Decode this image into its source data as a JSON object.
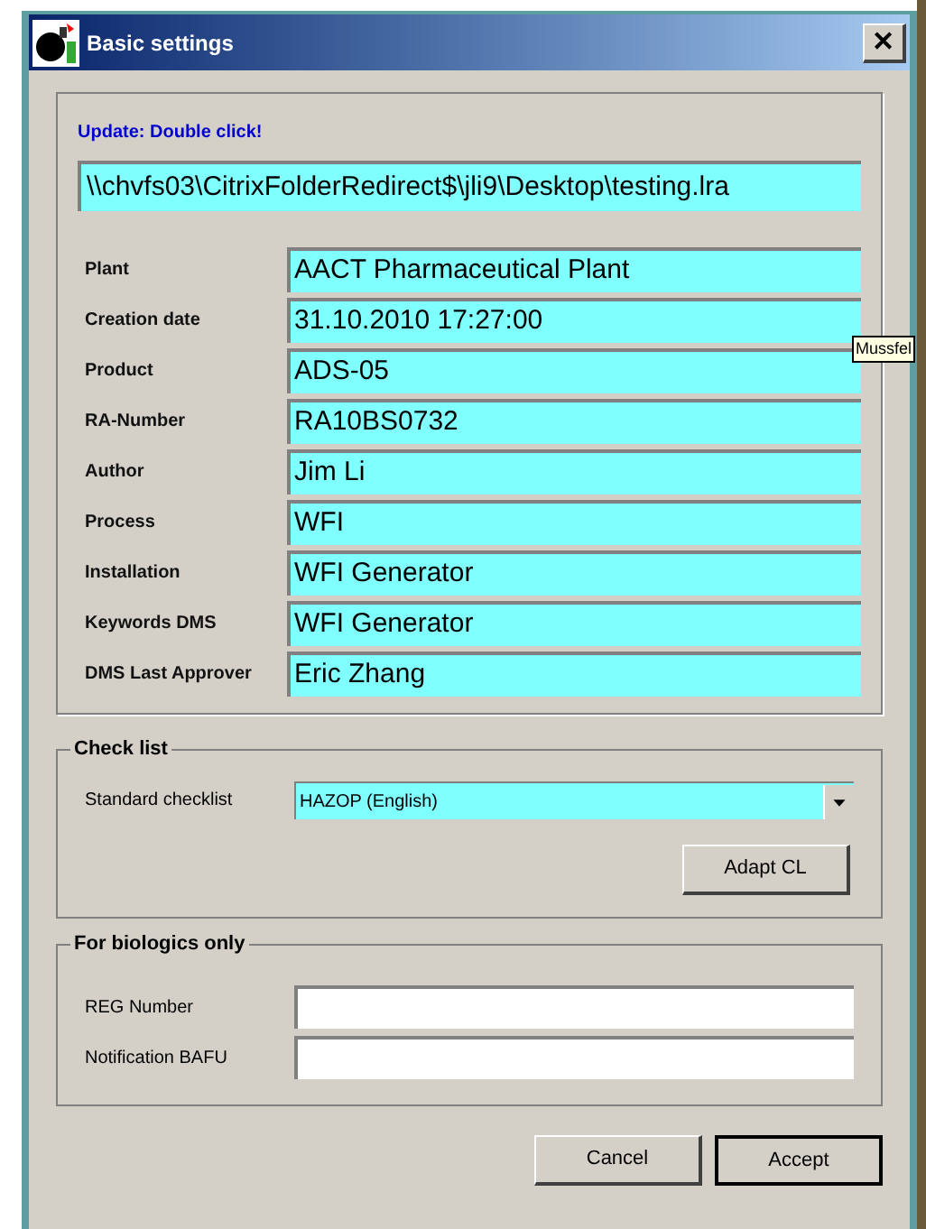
{
  "window": {
    "title": "Basic settings",
    "close": "✕"
  },
  "hint": "Update: Double click!",
  "file_path": "\\\\chvfs03\\CitrixFolderRedirect$\\jli9\\Desktop\\testing.lra",
  "fields": [
    {
      "label": "Plant",
      "value": "AACT Pharmaceutical Plant"
    },
    {
      "label": "Creation date",
      "value": "31.10.2010 17:27:00"
    },
    {
      "label": "Product",
      "value": "ADS-05"
    },
    {
      "label": "RA-Number",
      "value": "RA10BS0732"
    },
    {
      "label": "Author",
      "value": "Jim Li"
    },
    {
      "label": "Process",
      "value": "WFI"
    },
    {
      "label": "Installation",
      "value": "WFI Generator"
    },
    {
      "label": "Keywords DMS",
      "value": "WFI Generator"
    },
    {
      "label": "DMS Last Approver",
      "value": "Eric Zhang"
    }
  ],
  "tooltip": "Mussfel",
  "check_list": {
    "title": "Check list",
    "label": "Standard checklist",
    "value": "HAZOP (English)",
    "button": "Adapt CL"
  },
  "biologics": {
    "title": "For biologics only",
    "fields": [
      {
        "label": "REG Number"
      },
      {
        "label": "Notification BAFU"
      }
    ]
  },
  "buttons": [
    {
      "label": "Cancel",
      "default": false
    },
    {
      "label": "Accept",
      "default": true
    }
  ]
}
